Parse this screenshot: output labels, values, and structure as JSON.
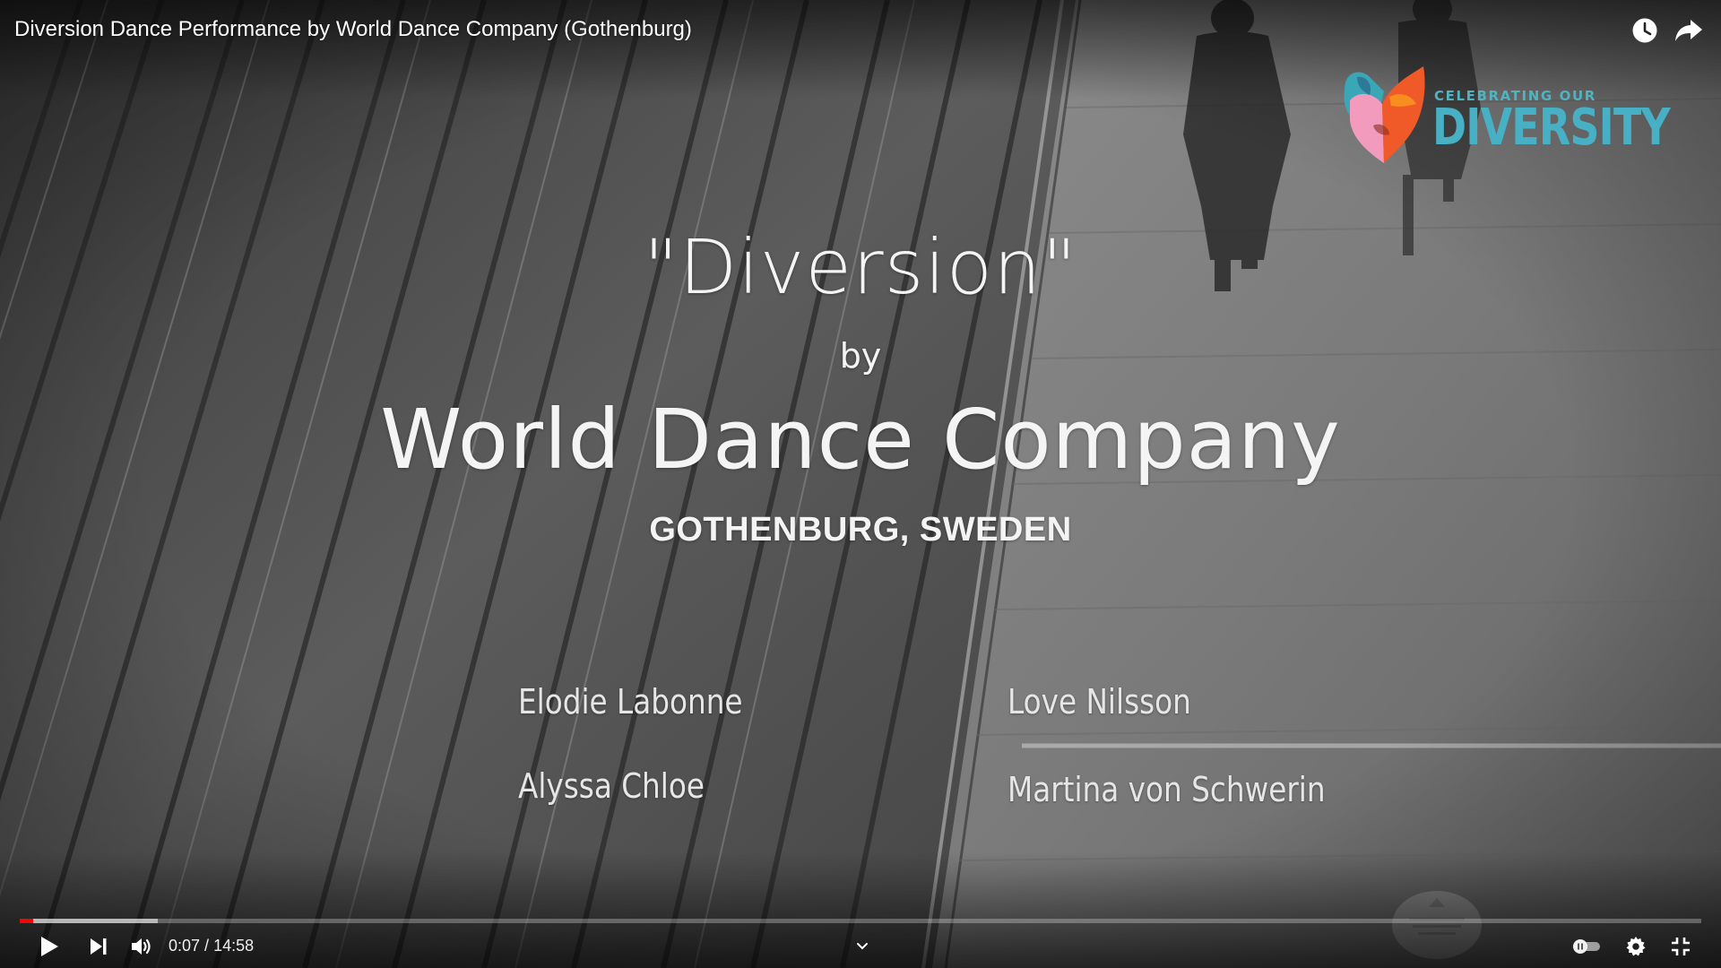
{
  "player": {
    "title": "Diversion Dance Performance by World Dance Company (Gothenburg)",
    "top_icons": [
      {
        "name": "watch-later-icon"
      },
      {
        "name": "share-icon"
      }
    ],
    "brand": {
      "line1": "CELEBRATING OUR",
      "line2": "DIVERSITY",
      "colors": {
        "teal": "#47b0c4",
        "orange": "#f05a28",
        "pink": "#f28cb1"
      }
    },
    "overlay": {
      "title": "\"Diversion\"",
      "by": "by",
      "company": "World Dance Company",
      "location": "GOTHENBURG, SWEDEN",
      "dancers": [
        "Elodie Labonne",
        "Love Nilsson",
        "Alyssa Chloe",
        "Martina von Schwerin"
      ]
    },
    "controls": {
      "current_time": "0:07",
      "separator": " / ",
      "duration": "14:58",
      "played_fraction": 0.008,
      "buffered_fraction": 0.082,
      "progress_color": "#ff0000",
      "icons": [
        "play-icon",
        "next-icon",
        "volume-icon",
        "chevron-down-icon",
        "autoplay-toggle-icon",
        "settings-gear-icon",
        "exit-fullscreen-icon"
      ]
    }
  }
}
